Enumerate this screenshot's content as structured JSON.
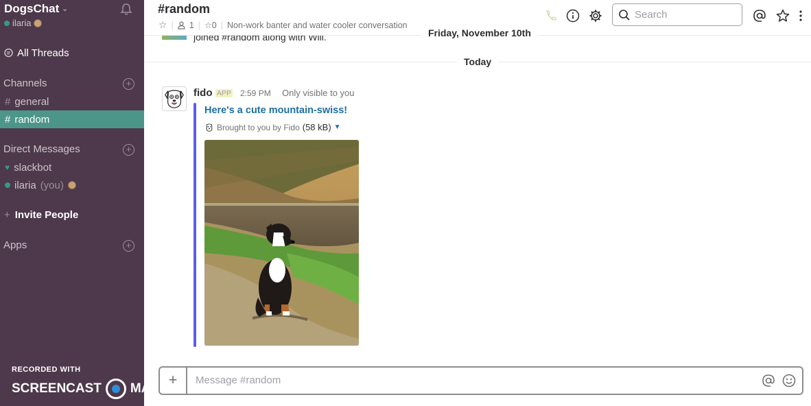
{
  "sidebar": {
    "team_name": "DogsChat",
    "user_name": "ilaria",
    "all_threads": "All Threads",
    "channels_title": "Channels",
    "channels": [
      {
        "label": "general"
      },
      {
        "label": "random"
      }
    ],
    "dm_title": "Direct Messages",
    "dms": [
      {
        "label": "slackbot"
      },
      {
        "label": "ilaria",
        "suffix": "(you)"
      }
    ],
    "invite": "Invite People",
    "apps_title": "Apps",
    "active_color": "#4c9689",
    "bg_color": "#4d394b"
  },
  "watermark": {
    "line1": "RECORDED WITH",
    "line2a": "SCREENCAST",
    "line2b": "MATIC"
  },
  "header": {
    "channel": "#random",
    "members": "1",
    "pins": "0",
    "topic": "Non-work banter and water cooler conversation",
    "search_placeholder": "Search"
  },
  "messages": {
    "partial_text": "joined #random along with Will.",
    "date1": "Friday, November 10th",
    "date2": "Today",
    "sender": "fido",
    "app_badge": "APP",
    "time": "2:59 PM",
    "visibility": "Only visible to you",
    "attach_title": "Here's a cute mountain-swiss!",
    "attach_by": "Brought to you by Fido",
    "attach_size": "(58 kB)",
    "attach_bar_color": "#5c5cf0"
  },
  "composer": {
    "placeholder": "Message #random"
  }
}
